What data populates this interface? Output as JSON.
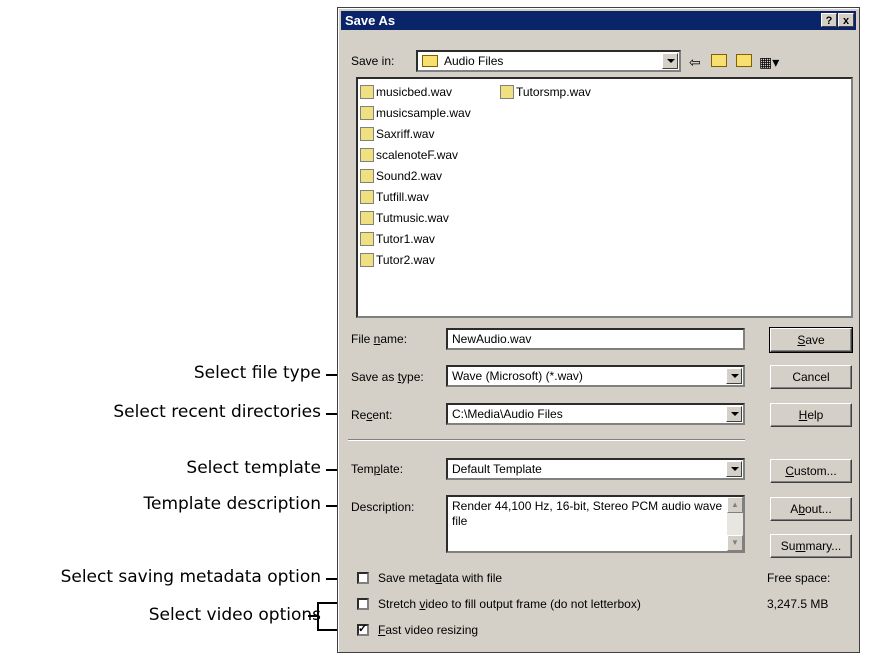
{
  "callouts": [
    "Select file type",
    "Select recent directories",
    "Select template",
    "Template description",
    "Select saving metadata option",
    "Select video options"
  ],
  "dialog": {
    "title": "Save As",
    "help_btn": "?",
    "close_btn": "x",
    "save_in_label": "Save in:",
    "save_in_value": "Audio Files",
    "files_col1": [
      "musicbed.wav",
      "musicsample.wav",
      "Saxriff.wav",
      "scalenoteF.wav",
      "Sound2.wav",
      "Tutfill.wav",
      "Tutmusic.wav",
      "Tutor1.wav",
      "Tutor2.wav"
    ],
    "files_col2": [
      "Tutorsmp.wav"
    ],
    "file_name_label": "File name:",
    "file_name_value": "NewAudio.wav",
    "save_type_label": "Save as type:",
    "save_type_value": "Wave (Microsoft) (*.wav)",
    "recent_label": "Recent:",
    "recent_value": "C:\\Media\\Audio Files",
    "template_label": "Template:",
    "template_value": "Default Template",
    "description_label": "Description:",
    "description_value": "Render 44,100 Hz, 16-bit, Stereo PCM audio wave file",
    "buttons": {
      "save": "Save",
      "cancel": "Cancel",
      "help": "Help",
      "custom": "Custom...",
      "about": "About...",
      "summary": "Summary..."
    },
    "chk_metadata": "Save metadata with file",
    "chk_stretch": "Stretch video to fill output frame (do not letterbox)",
    "chk_fast": "Fast video resizing",
    "free_space_label": "Free space:",
    "free_space_value": "3,247.5 MB"
  }
}
